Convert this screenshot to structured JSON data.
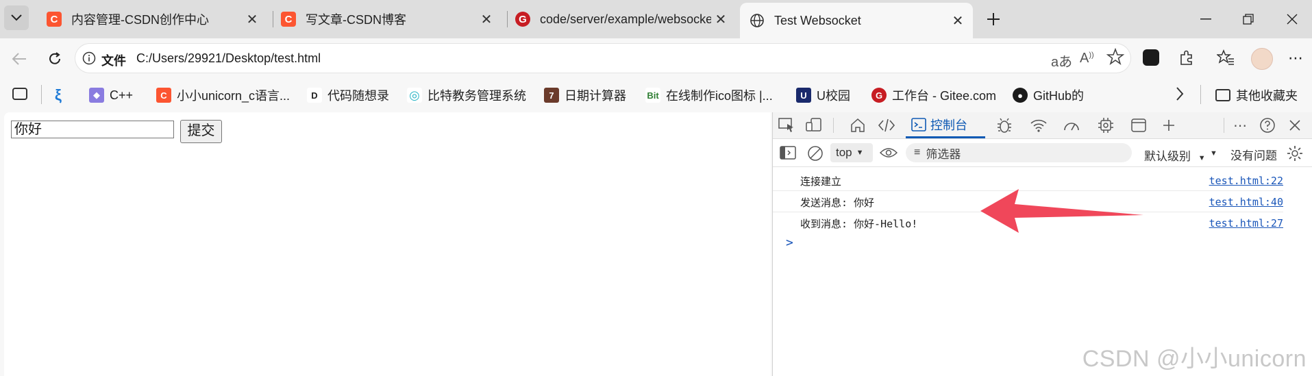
{
  "browser": {
    "tabs": [
      {
        "title": "内容管理-CSDN创作中心",
        "icon": "csdn-icon"
      },
      {
        "title": "写文章-CSDN博客",
        "icon": "csdn-icon"
      },
      {
        "title": "code/server/example/websocketp",
        "icon": "gitee-icon"
      },
      {
        "title": "Test Websocket",
        "icon": "globe-icon",
        "active": true
      }
    ],
    "address": {
      "label": "文件",
      "url": "C:/Users/29921/Desktop/test.html"
    },
    "favorites": [
      {
        "label": "C++",
        "icon": "cpp-fav-icon"
      },
      {
        "label": "小小unicorn_c语言...",
        "icon": "csdn-fav-icon"
      },
      {
        "label": "代码随想录",
        "icon": "dmsxl-fav-icon"
      },
      {
        "label": "比特教务管理系统",
        "icon": "bit-edu-fav-icon"
      },
      {
        "label": "日期计算器",
        "icon": "calendar-fav-icon"
      },
      {
        "label": "在线制作ico图标 |...",
        "icon": "ico-fav-icon"
      },
      {
        "label": "U校园",
        "icon": "u-campus-fav-icon"
      },
      {
        "label": "工作台 - Gitee.com",
        "icon": "gitee-fav-icon"
      },
      {
        "label": "GitHub的",
        "icon": "github-fav-icon"
      }
    ],
    "other_favorites": "其他收藏夹"
  },
  "page": {
    "input_value": "你好",
    "submit_label": "提交"
  },
  "devtools": {
    "console_tab": "控制台",
    "context": "top",
    "filter_placeholder": "筛选器",
    "levels": "默认级别",
    "issues": "没有问题",
    "messages": [
      {
        "text": "连接建立",
        "source": "test.html:22"
      },
      {
        "text": "发送消息: 你好",
        "source": "test.html:40"
      },
      {
        "text": "收到消息: 你好-Hello!",
        "source": "test.html:27"
      }
    ],
    "prompt": ">"
  },
  "watermark": "CSDN @小小unicorn",
  "colors": {
    "accent": "#0f5ab4",
    "csdn": "#fc5531",
    "gitee": "#c71d23",
    "arrow": "#f0475a"
  }
}
